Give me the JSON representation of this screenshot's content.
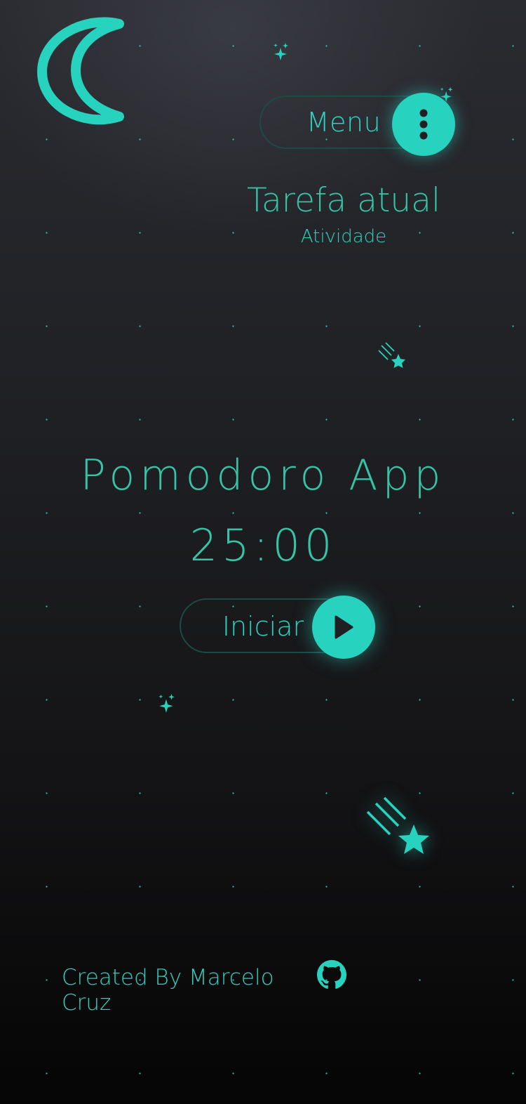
{
  "header": {
    "menu_label": "Menu",
    "menu_icon": "more-vertical-icon",
    "theme_icon": "moon-icon"
  },
  "task": {
    "title": "Tarefa atual",
    "subtitle": "Atividade"
  },
  "main": {
    "app_title": "Pomodoro App",
    "timer": "25:00",
    "start_label": "Iniciar",
    "start_icon": "play-icon"
  },
  "footer": {
    "credit": "Created By Marcelo Cruz",
    "github_icon": "github-icon"
  },
  "colors": {
    "accent": "#27d3bf",
    "text": "#36c4a6",
    "border": "#1d4a45",
    "background_top": "#2a2b30",
    "background_bottom": "#050505"
  }
}
